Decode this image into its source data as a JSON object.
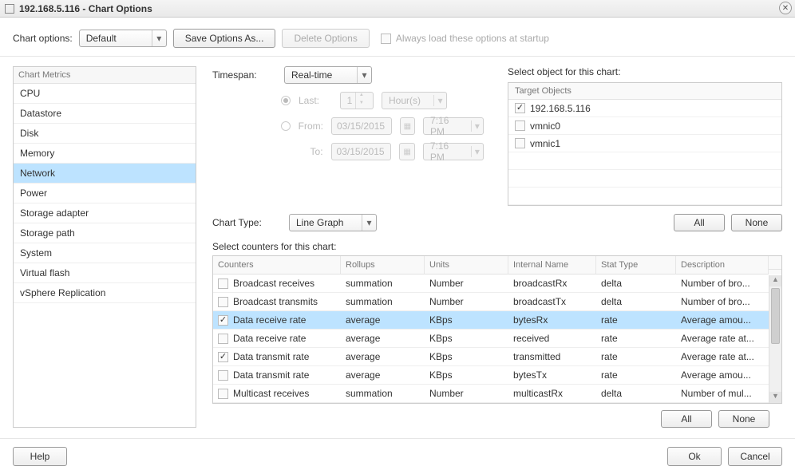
{
  "window": {
    "title": "192.168.5.116 - Chart Options"
  },
  "toolbar": {
    "chart_options_label": "Chart options:",
    "chart_options_value": "Default",
    "save_options_as": "Save Options As...",
    "delete_options": "Delete Options",
    "always_load": "Always load these options at startup"
  },
  "metrics": {
    "header": "Chart Metrics",
    "items": [
      {
        "label": "CPU",
        "selected": false
      },
      {
        "label": "Datastore",
        "selected": false
      },
      {
        "label": "Disk",
        "selected": false
      },
      {
        "label": "Memory",
        "selected": false
      },
      {
        "label": "Network",
        "selected": true
      },
      {
        "label": "Power",
        "selected": false
      },
      {
        "label": "Storage adapter",
        "selected": false
      },
      {
        "label": "Storage path",
        "selected": false
      },
      {
        "label": "System",
        "selected": false
      },
      {
        "label": "Virtual flash",
        "selected": false
      },
      {
        "label": "vSphere Replication",
        "selected": false
      }
    ]
  },
  "timespan": {
    "label": "Timespan:",
    "value": "Real-time",
    "last_label": "Last:",
    "last_value": "1",
    "last_unit": "Hour(s)",
    "from_label": "From:",
    "from_date": "03/15/2015",
    "from_time": "7:16 PM",
    "to_label": "To:",
    "to_date": "03/15/2015",
    "to_time": "7:16 PM"
  },
  "objects": {
    "title": "Select object for this chart:",
    "header": "Target Objects",
    "items": [
      {
        "label": "192.168.5.116",
        "checked": true
      },
      {
        "label": "vmnic0",
        "checked": false
      },
      {
        "label": "vmnic1",
        "checked": false
      }
    ]
  },
  "chart_type": {
    "label": "Chart Type:",
    "value": "Line Graph"
  },
  "buttons": {
    "all": "All",
    "none": "None",
    "help": "Help",
    "ok": "Ok",
    "cancel": "Cancel"
  },
  "counters": {
    "label": "Select counters for this chart:",
    "headers": {
      "counters": "Counters",
      "rollups": "Rollups",
      "units": "Units",
      "internal": "Internal Name",
      "stat": "Stat Type",
      "desc": "Description"
    },
    "rows": [
      {
        "checked": false,
        "selected": false,
        "name": "Broadcast receives",
        "rollup": "summation",
        "units": "Number",
        "internal": "broadcastRx",
        "stat": "delta",
        "desc": "Number of bro..."
      },
      {
        "checked": false,
        "selected": false,
        "name": "Broadcast transmits",
        "rollup": "summation",
        "units": "Number",
        "internal": "broadcastTx",
        "stat": "delta",
        "desc": "Number of bro..."
      },
      {
        "checked": true,
        "selected": true,
        "name": "Data receive rate",
        "rollup": "average",
        "units": "KBps",
        "internal": "bytesRx",
        "stat": "rate",
        "desc": "Average amou..."
      },
      {
        "checked": false,
        "selected": false,
        "name": "Data receive rate",
        "rollup": "average",
        "units": "KBps",
        "internal": "received",
        "stat": "rate",
        "desc": "Average rate at..."
      },
      {
        "checked": true,
        "selected": false,
        "name": "Data transmit rate",
        "rollup": "average",
        "units": "KBps",
        "internal": "transmitted",
        "stat": "rate",
        "desc": "Average rate at..."
      },
      {
        "checked": false,
        "selected": false,
        "name": "Data transmit rate",
        "rollup": "average",
        "units": "KBps",
        "internal": "bytesTx",
        "stat": "rate",
        "desc": "Average amou..."
      },
      {
        "checked": false,
        "selected": false,
        "name": "Multicast receives",
        "rollup": "summation",
        "units": "Number",
        "internal": "multicastRx",
        "stat": "delta",
        "desc": "Number of mul..."
      }
    ]
  }
}
